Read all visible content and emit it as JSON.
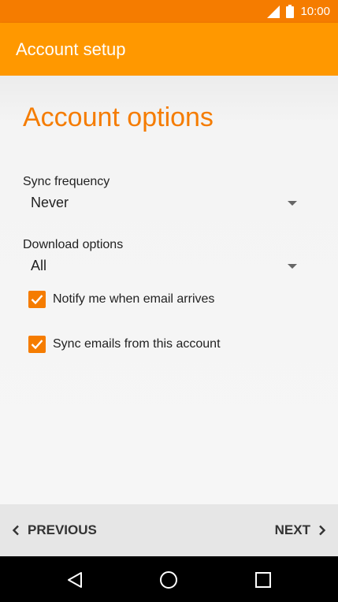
{
  "status_bar": {
    "time": "10:00",
    "icons": [
      "signal-icon",
      "battery-icon"
    ]
  },
  "app_bar": {
    "title": "Account setup"
  },
  "main": {
    "heading": "Account options",
    "sync_frequency": {
      "label": "Sync frequency",
      "value": "Never"
    },
    "download_options": {
      "label": "Download options",
      "value": "All"
    },
    "checkboxes": [
      {
        "label": "Notify me when email arrives",
        "checked": true
      },
      {
        "label": "Sync emails from this account",
        "checked": true
      }
    ]
  },
  "bottom_bar": {
    "previous_label": "PREVIOUS",
    "next_label": "NEXT"
  },
  "system_nav": {
    "buttons": [
      "back-icon",
      "home-icon",
      "recents-icon"
    ]
  },
  "colors": {
    "status_bar": "#f57c00",
    "app_bar": "#ff9800",
    "accent": "#f57c00"
  }
}
